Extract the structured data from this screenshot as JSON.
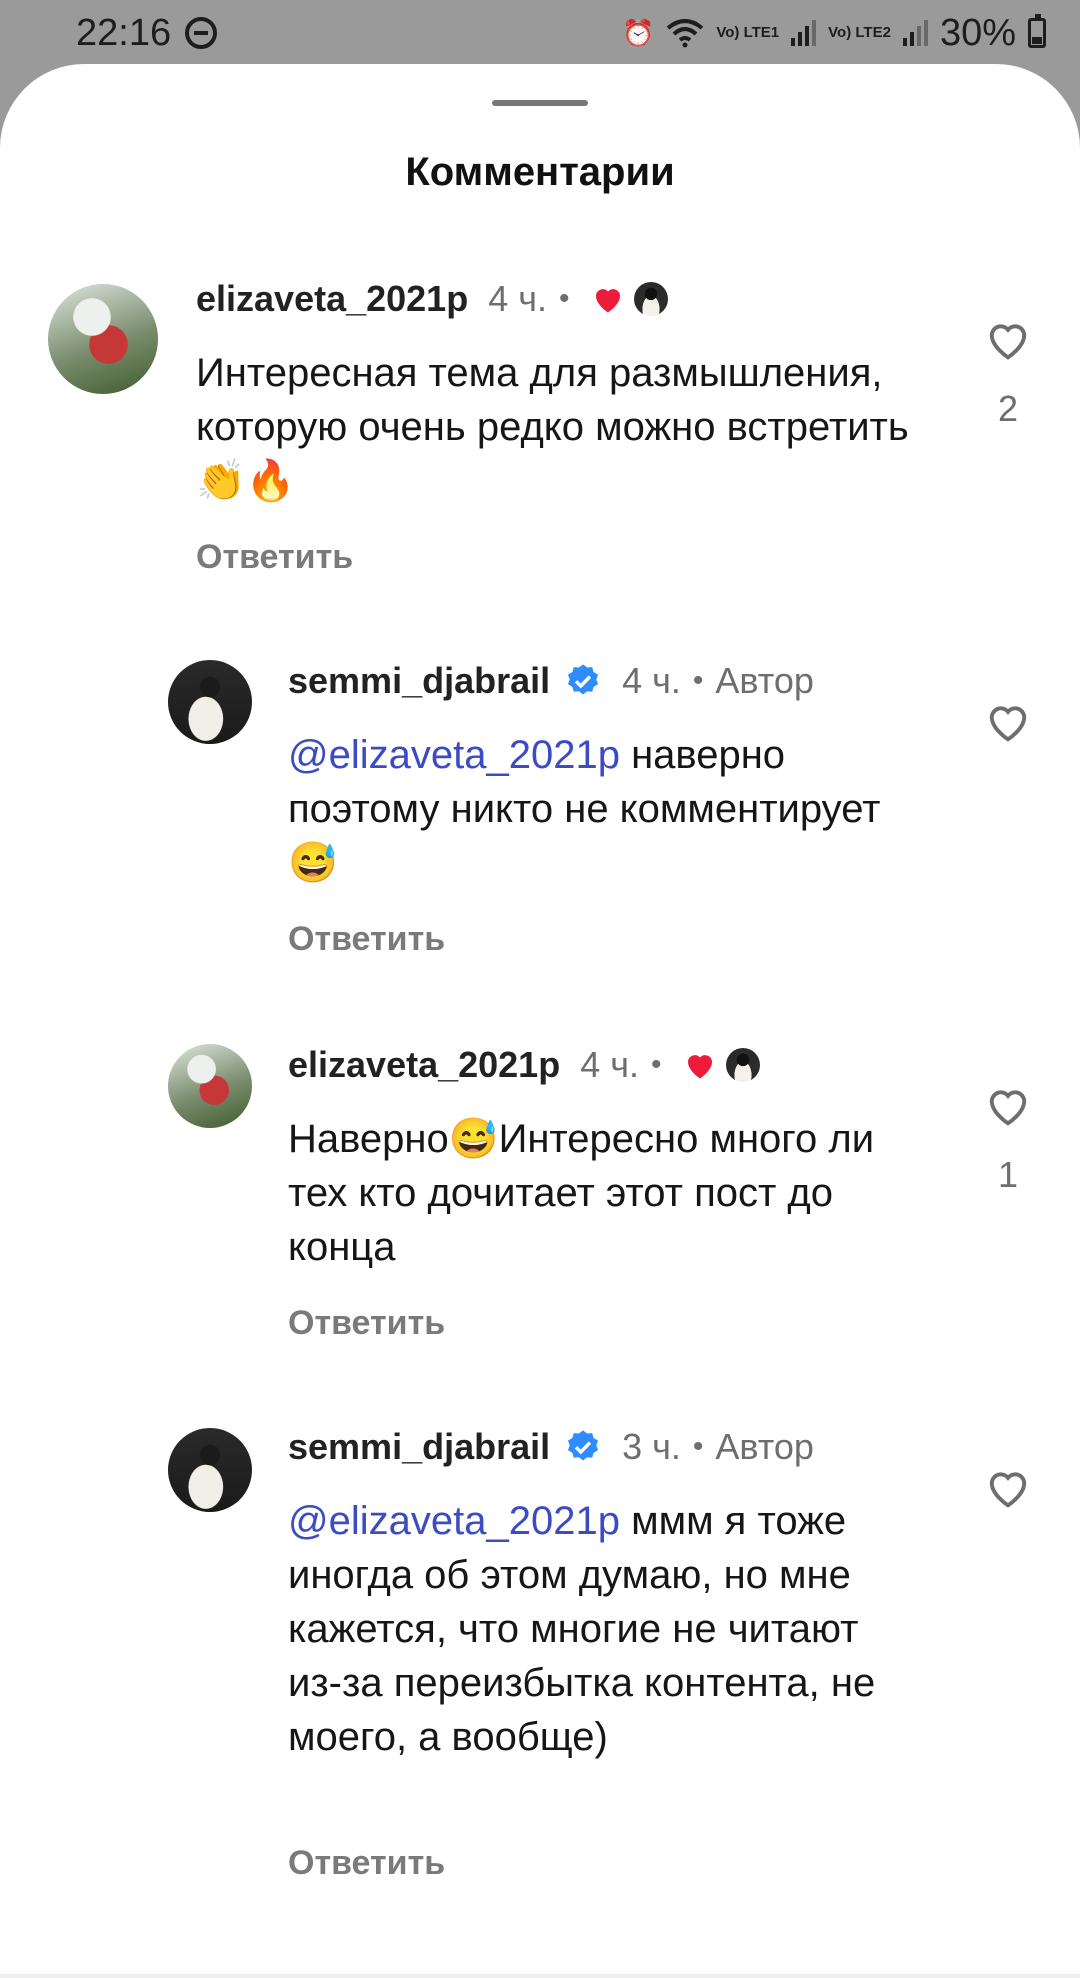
{
  "status_bar": {
    "time": "22:16",
    "lte1": "Vo) LTE1",
    "lte2": "Vo) LTE2",
    "battery": "30%",
    "icons": [
      "do-not-disturb-icon",
      "alarm-icon",
      "wifi-icon",
      "signal-icon",
      "battery-icon"
    ]
  },
  "sheet": {
    "title": "Комментарии"
  },
  "colors": {
    "mention": "#3b4bc4",
    "heart_red": "#ed1c3b",
    "verified_blue": "#2f8cff"
  },
  "comments": [
    {
      "username": "elizaveta_2021p",
      "time": "4 ч.",
      "dot": "•",
      "text": "Интересная тема для размышления, которую очень редко можно встретить 👏🔥",
      "reply_label": "Ответить",
      "like_count": "2",
      "liked_by_author": true
    },
    {
      "username": "semmi_djabrail",
      "time": "4 ч.",
      "dot": "•",
      "author_label": "Автор",
      "mention": "@elizaveta_2021p",
      "text": " наверно поэтому никто не комментирует 😅",
      "reply_label": "Ответить",
      "verified": true
    },
    {
      "username": "elizaveta_2021p",
      "time": "4 ч.",
      "dot": "•",
      "text": "Наверно😅Интересно много ли тех кто дочитает этот пост до конца",
      "reply_label": "Ответить",
      "like_count": "1",
      "liked_by_author": true
    },
    {
      "username": "semmi_djabrail",
      "time": "3 ч.",
      "dot": "•",
      "author_label": "Автор",
      "mention": "@elizaveta_2021p",
      "text": " ммм я тоже иногда об этом думаю, но мне кажется, что многие не читают из-за переизбытка контента, не моего, а вообще)",
      "reply_label": "Ответить",
      "verified": true
    }
  ]
}
